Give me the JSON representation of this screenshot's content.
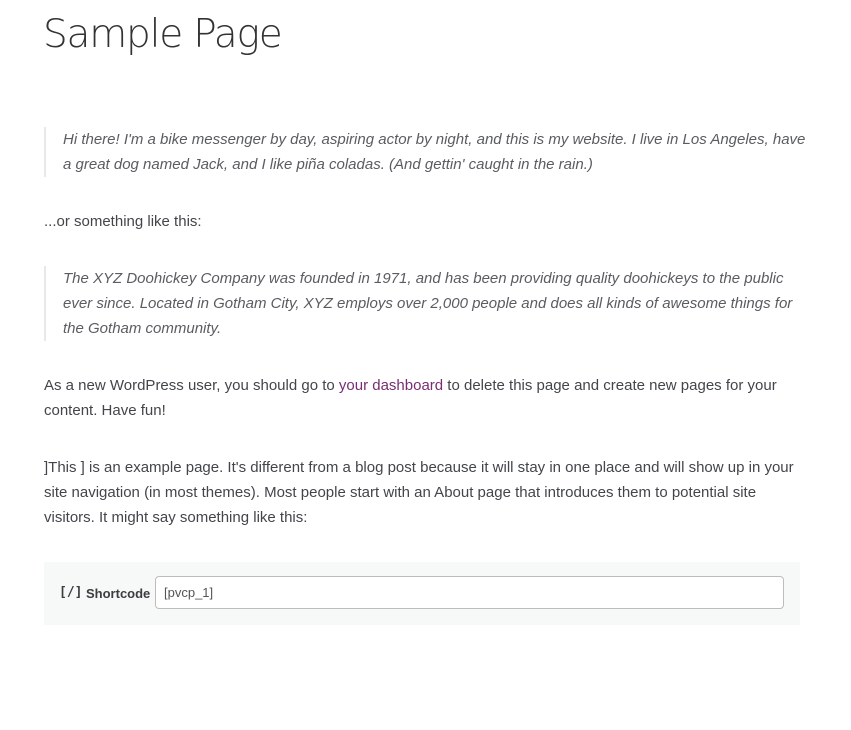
{
  "page": {
    "title": "Sample Page"
  },
  "content": {
    "quote1": "Hi there! I'm a bike messenger by day, aspiring actor by night, and this is my website. I live in Los Angeles, have a great dog named Jack, and I like piña coladas. (And gettin' caught in the rain.)",
    "para1": "...or something like this:",
    "quote2": "The XYZ Doohickey Company was founded in 1971, and has been providing quality doohickeys to the public ever since. Located in Gotham City, XYZ employs over 2,000 people and does all kinds of awesome things for the Gotham community.",
    "para2_before": "As a new WordPress user, you should go to ",
    "para2_link": "your dashboard",
    "para2_after": " to delete this page and create new pages for your content. Have fun!",
    "para3": "]This ]  is an example page. It's different from a blog post because it will stay in one place and will show up in your site navigation (in most themes). Most people start with an About page that introduces them to potential site visitors. It might say something like this:"
  },
  "shortcode": {
    "icon": "[/]",
    "label": "Shortcode",
    "value": "[pvcp_1]"
  },
  "colors": {
    "link": "#7a2d70",
    "text": "#43454b",
    "title": "#333333",
    "shortcode_bg": "#f7f8f8"
  }
}
